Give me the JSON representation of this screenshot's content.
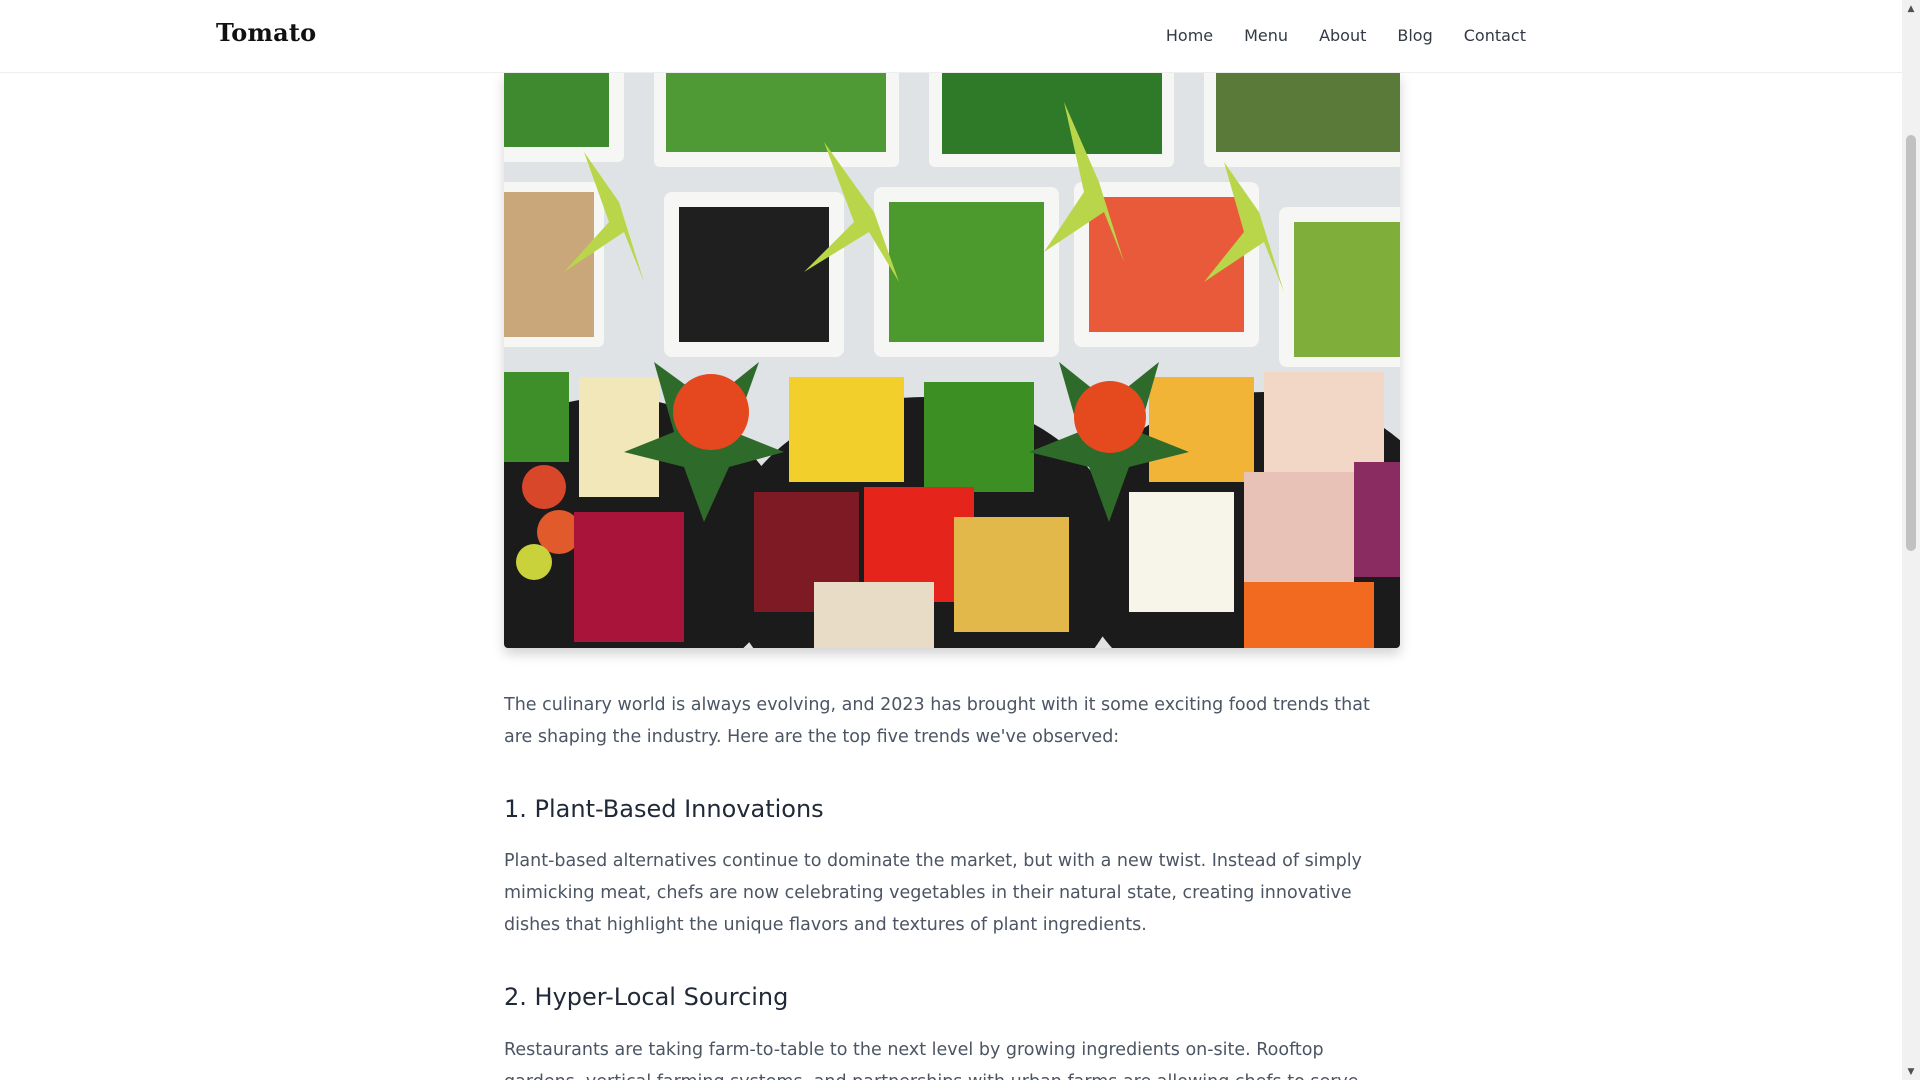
{
  "header": {
    "brand": "Tomato",
    "nav": [
      "Home",
      "Menu",
      "About",
      "Blog",
      "Contact"
    ]
  },
  "article": {
    "intro": "The culinary world is always evolving, and 2023 has brought with it some exciting food trends that are shaping the industry. Here are the top five trends we've observed:",
    "sections": [
      {
        "heading": "1. Plant-Based Innovations",
        "body": "Plant-based alternatives continue to dominate the market, but with a new twist. Instead of simply mimicking meat, chefs are now celebrating vegetables in their natural state, creating innovative dishes that highlight the unique flavors and textures of plant ingredients."
      },
      {
        "heading": "2. Hyper-Local Sourcing",
        "body": "Restaurants are taking farm-to-table to the next level by growing ingredients on-site. Rooftop gardens, vertical farming systems, and partnerships with urban farms are allowing chefs to serve produce that was harvested just hours before it reaches the plate."
      }
    ]
  },
  "colors": {
    "brand": "#111111",
    "nav_text": "#333a44",
    "body_text": "#4b5563",
    "heading_text": "#1f2937"
  },
  "icons": {
    "scroll_up": "scroll-up-arrow-icon",
    "scroll_down": "scroll-down-arrow-icon"
  }
}
